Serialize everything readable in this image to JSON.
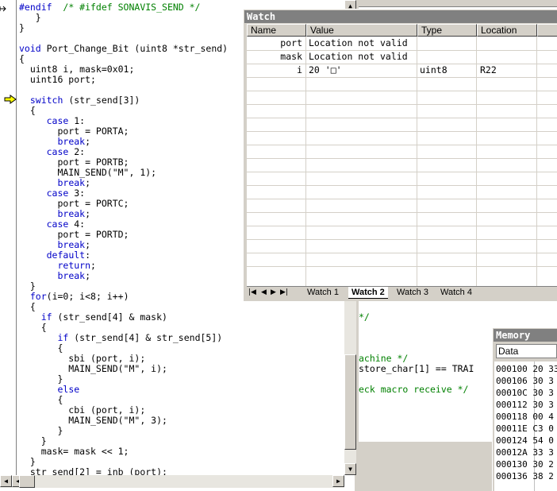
{
  "editor": {
    "lines": [
      [
        {
          "t": "#endif  ",
          "c": "kw"
        },
        {
          "t": "/* #ifdef SONAVIS_SEND */",
          "c": "cm"
        }
      ],
      [
        {
          "t": "   }"
        }
      ],
      [
        {
          "t": "}"
        }
      ],
      [
        {
          "t": ""
        }
      ],
      [
        {
          "t": "void",
          "c": "kw"
        },
        {
          "t": " Port_Change_Bit (uint8 *str_send)"
        }
      ],
      [
        {
          "t": "{"
        }
      ],
      [
        {
          "t": "  uint8 i, mask=0x01;"
        }
      ],
      [
        {
          "t": "  uint16 port;"
        }
      ],
      [
        {
          "t": ""
        }
      ],
      [
        {
          "t": "  "
        },
        {
          "t": "switch",
          "c": "kw"
        },
        {
          "t": " (str_send[3])"
        }
      ],
      [
        {
          "t": "  {"
        }
      ],
      [
        {
          "t": "     "
        },
        {
          "t": "case",
          "c": "kw"
        },
        {
          "t": " 1:"
        }
      ],
      [
        {
          "t": "       port = PORTA;"
        }
      ],
      [
        {
          "t": "       "
        },
        {
          "t": "break",
          "c": "kw"
        },
        {
          "t": ";"
        }
      ],
      [
        {
          "t": "     "
        },
        {
          "t": "case",
          "c": "kw"
        },
        {
          "t": " 2:"
        }
      ],
      [
        {
          "t": "       port = PORTB;"
        }
      ],
      [
        {
          "t": "       MAIN_SEND(\"M\", 1);"
        }
      ],
      [
        {
          "t": "       "
        },
        {
          "t": "break",
          "c": "kw"
        },
        {
          "t": ";"
        }
      ],
      [
        {
          "t": "     "
        },
        {
          "t": "case",
          "c": "kw"
        },
        {
          "t": " 3:"
        }
      ],
      [
        {
          "t": "       port = PORTC;"
        }
      ],
      [
        {
          "t": "       "
        },
        {
          "t": "break",
          "c": "kw"
        },
        {
          "t": ";"
        }
      ],
      [
        {
          "t": "     "
        },
        {
          "t": "case",
          "c": "kw"
        },
        {
          "t": " 4:"
        }
      ],
      [
        {
          "t": "       port = PORTD;"
        }
      ],
      [
        {
          "t": "       "
        },
        {
          "t": "break",
          "c": "kw"
        },
        {
          "t": ";"
        }
      ],
      [
        {
          "t": "     "
        },
        {
          "t": "default",
          "c": "kw"
        },
        {
          "t": ":"
        }
      ],
      [
        {
          "t": "       "
        },
        {
          "t": "return",
          "c": "kw"
        },
        {
          "t": ";"
        }
      ],
      [
        {
          "t": "       "
        },
        {
          "t": "break",
          "c": "kw"
        },
        {
          "t": ";"
        }
      ],
      [
        {
          "t": "  }"
        }
      ],
      [
        {
          "t": "  "
        },
        {
          "t": "for",
          "c": "kw"
        },
        {
          "t": "(i=0; i<8; i++)"
        }
      ],
      [
        {
          "t": "  {"
        }
      ],
      [
        {
          "t": "    "
        },
        {
          "t": "if",
          "c": "kw"
        },
        {
          "t": " (str_send[4] & mask)"
        }
      ],
      [
        {
          "t": "    {"
        }
      ],
      [
        {
          "t": "       "
        },
        {
          "t": "if",
          "c": "kw"
        },
        {
          "t": " (str_send[4] & str_send[5])"
        }
      ],
      [
        {
          "t": "       {"
        }
      ],
      [
        {
          "t": "         sbi (port, i);"
        }
      ],
      [
        {
          "t": "         MAIN_SEND(\"M\", i);"
        }
      ],
      [
        {
          "t": "       }"
        }
      ],
      [
        {
          "t": "       "
        },
        {
          "t": "else",
          "c": "kw"
        }
      ],
      [
        {
          "t": "       {"
        }
      ],
      [
        {
          "t": "         cbi (port, i);"
        }
      ],
      [
        {
          "t": "         MAIN_SEND(\"M\", 3);"
        }
      ],
      [
        {
          "t": "       }"
        }
      ],
      [
        {
          "t": "    }"
        }
      ],
      [
        {
          "t": "    mask= mask << 1;"
        }
      ],
      [
        {
          "t": "  }"
        }
      ],
      [
        {
          "t": "  str_send[2] = inb (port);"
        }
      ]
    ]
  },
  "editor2": {
    "lines": [
      {
        "text": "*/",
        "c": "cm",
        "row": 30
      },
      {
        "text": "achine */",
        "c": "cm",
        "row": 34
      },
      {
        "text": "store_char[1] == TRAI",
        "c": "",
        "row": 35
      },
      {
        "text": "eck macro receive */",
        "c": "cm",
        "row": 37
      }
    ]
  },
  "watch": {
    "title": "Watch",
    "columns": [
      "Name",
      "Value",
      "Type",
      "Location"
    ],
    "rows": [
      {
        "name": "port",
        "value": "Location not valid",
        "type": "",
        "location": ""
      },
      {
        "name": "mask",
        "value": "Location not valid",
        "type": "",
        "location": ""
      },
      {
        "name": "i",
        "value": "20 '□'",
        "type": "uint8",
        "location": "R22"
      }
    ],
    "empty_rows": 14,
    "tabs": [
      "Watch 1",
      "Watch 2",
      "Watch 3",
      "Watch 4"
    ],
    "active_tab": 1
  },
  "memory": {
    "title": "Memory",
    "select_value": "Data",
    "rows": [
      "000100 20 33",
      "000106 30 3",
      "00010C 30 3",
      "000112 30 3",
      "000118 00 4",
      "00011E C3 0",
      "000124 54 0",
      "00012A 33 3",
      "000130 30 2",
      "000136 38 2"
    ]
  }
}
